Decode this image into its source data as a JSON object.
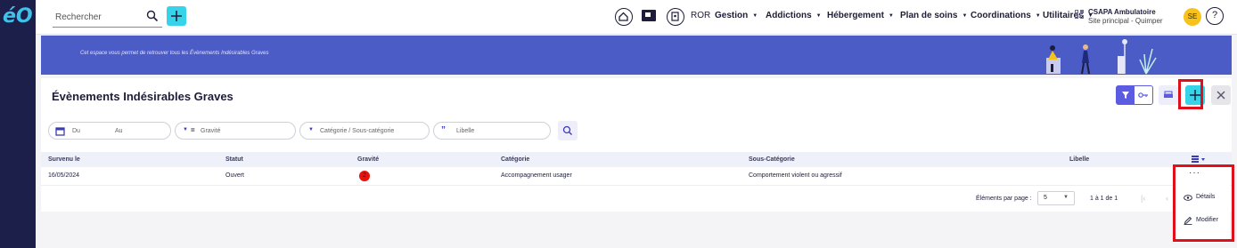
{
  "app": {
    "logo": "éO"
  },
  "topbar": {
    "search_placeholder": "Rechercher",
    "ror_label": "ROR",
    "nav": [
      {
        "label": "Gestion"
      },
      {
        "label": "Addictions"
      },
      {
        "label": "Hébergement"
      },
      {
        "label": "Plan de soins"
      },
      {
        "label": "Coordinations"
      },
      {
        "label": "Utilitaires"
      }
    ],
    "org_name": "CSAPA Ambulatoire",
    "org_site": "Site principal - Quimper",
    "avatar_initials": "SE",
    "help_label": "?"
  },
  "banner": {
    "text": "Cet espace vous permet de retrouver tous les Évènements Indésirables Graves"
  },
  "page": {
    "title": "Évènements Indésirables Graves"
  },
  "filters": {
    "date_from": "Du",
    "date_to": "Au",
    "gravite": "Gravité",
    "categorie": "Catégorie / Sous-catégorie",
    "libelle": "Libelle"
  },
  "table": {
    "columns": [
      "Survenu le",
      "Statut",
      "Gravité",
      "Catégorie",
      "Sous-Catégorie",
      "Libelle"
    ],
    "rows": [
      {
        "survenu": "16/05/2024",
        "statut": "Ouvert",
        "gravite": "2",
        "categorie": "Accompagnement usager",
        "sous_categorie": "Comportement violent ou agressif",
        "libelle": ""
      }
    ],
    "more_label": "···"
  },
  "pagination": {
    "per_page_label": "Éléments par page :",
    "per_page_value": "5",
    "range": "1 à 1 de 1"
  },
  "context_menu": {
    "items": [
      {
        "label": "Détails"
      },
      {
        "label": "Modifier"
      }
    ]
  },
  "colors": {
    "sidebar": "#1c1f4a",
    "banner": "#4c5cc6",
    "accent": "#37d3e8",
    "primary": "#5b5ce0",
    "highlight": "#e0101a",
    "severity": "#e8120c"
  }
}
